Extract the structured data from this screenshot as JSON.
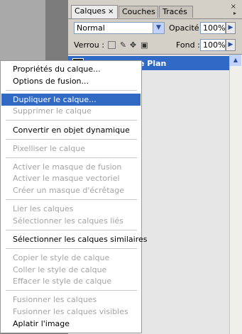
{
  "panel": {
    "tabs": [
      {
        "label": "Calques",
        "close": "×"
      },
      {
        "label": "Couches"
      },
      {
        "label": "Tracés"
      }
    ],
    "close_icon": "×",
    "menu_icon": "▸",
    "blend_mode": "Normal",
    "opacity_label": "Opacité :",
    "opacity_value": "100%",
    "lock_label": "Verrou :",
    "fill_label": "Fond :",
    "fill_value": "100%",
    "layer_name": "e Plan"
  },
  "context_menu": {
    "items": [
      {
        "label": "Propriétés du calque...",
        "enabled": true
      },
      {
        "label": "Options de fusion...",
        "enabled": true
      },
      {
        "label": "Dupliquer le calque...",
        "enabled": true,
        "highlighted": true
      },
      {
        "label": "Supprimer le calque",
        "enabled": false
      },
      {
        "label": "Convertir en objet dynamique",
        "enabled": true
      },
      {
        "label": "Pixelliser le calque",
        "enabled": false
      },
      {
        "label": "Activer le masque de fusion",
        "enabled": false
      },
      {
        "label": "Activer le masque vectoriel",
        "enabled": false
      },
      {
        "label": "Créer un masque d'écrêtage",
        "enabled": false
      },
      {
        "label": "Lier les calques",
        "enabled": false
      },
      {
        "label": "Sélectionner les calques liés",
        "enabled": false
      },
      {
        "label": "Sélectionner les calques similaires",
        "enabled": true
      },
      {
        "label": "Copier le style de calque",
        "enabled": false
      },
      {
        "label": "Coller le style de calque",
        "enabled": false
      },
      {
        "label": "Effacer le style de calque",
        "enabled": false
      },
      {
        "label": "Fusionner les calques",
        "enabled": false
      },
      {
        "label": "Fusionner les calques visibles",
        "enabled": false
      },
      {
        "label": "Aplatir l'image",
        "enabled": true
      }
    ]
  }
}
